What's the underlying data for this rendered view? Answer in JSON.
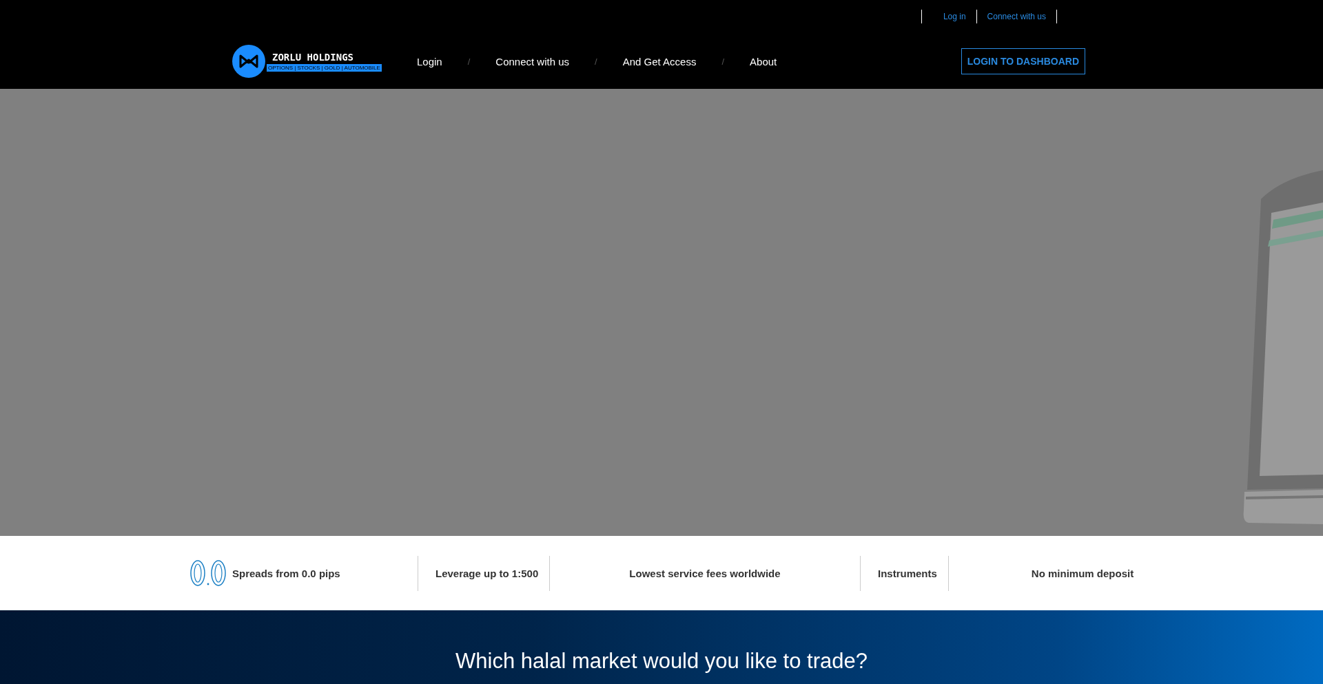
{
  "top_links": [
    "Log in",
    "Connect with us"
  ],
  "logo": {
    "name": "ZORLU HOLDINGS",
    "tagline": "OPTIONS | STOCKS | GOLD | AUTOMOBILE"
  },
  "nav": {
    "items": [
      "Login",
      "Connect with us",
      "And Get Access",
      "About"
    ],
    "separator": "/"
  },
  "dashboard_button": "LOGIN TO DASHBOARD",
  "features": [
    {
      "label": "Spreads from 0.0 pips",
      "kind": "icon"
    },
    {
      "label": "Leverage up to 1:500",
      "kind": "plain"
    },
    {
      "label": "Lowest service fees worldwide",
      "kind": "centered"
    },
    {
      "label": "Instruments",
      "kind": "plain"
    },
    {
      "label": "No minimum deposit",
      "kind": "centered"
    }
  ],
  "markets": {
    "heading": "Which halal market would you like to trade?"
  }
}
